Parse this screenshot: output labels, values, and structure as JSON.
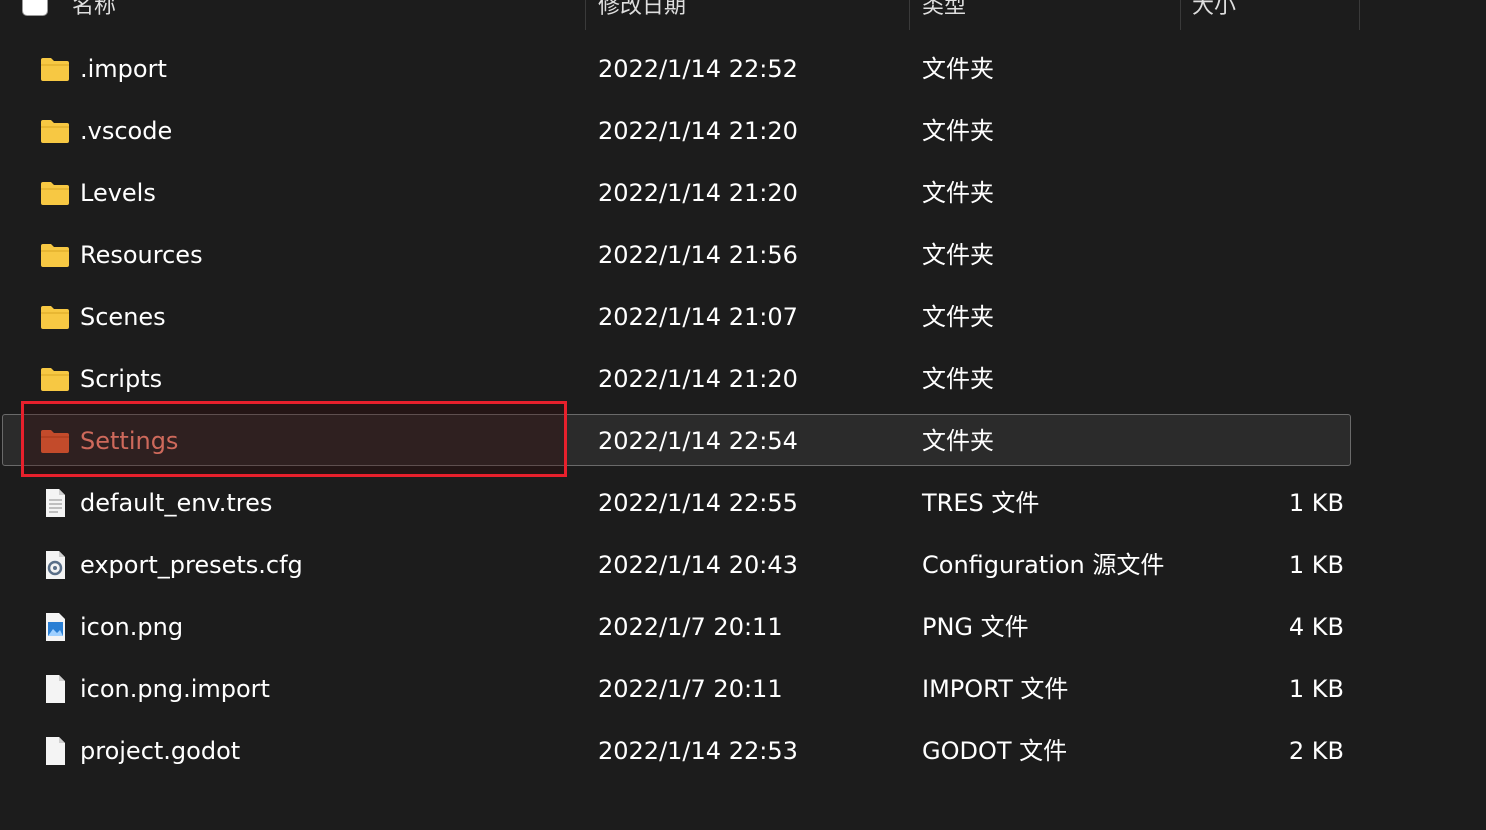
{
  "header": {
    "name": "名称",
    "date": "修改日期",
    "type": "类型",
    "size": "大小"
  },
  "rows": [
    {
      "name": ".import",
      "date": "2022/1/14 22:52",
      "type": "文件夹",
      "size": "",
      "icon": "folder-icon"
    },
    {
      "name": ".vscode",
      "date": "2022/1/14 21:20",
      "type": "文件夹",
      "size": "",
      "icon": "folder-icon"
    },
    {
      "name": "Levels",
      "date": "2022/1/14 21:20",
      "type": "文件夹",
      "size": "",
      "icon": "folder-icon"
    },
    {
      "name": "Resources",
      "date": "2022/1/14 21:56",
      "type": "文件夹",
      "size": "",
      "icon": "folder-icon"
    },
    {
      "name": "Scenes",
      "date": "2022/1/14 21:07",
      "type": "文件夹",
      "size": "",
      "icon": "folder-icon"
    },
    {
      "name": "Scripts",
      "date": "2022/1/14 21:20",
      "type": "文件夹",
      "size": "",
      "icon": "folder-icon"
    },
    {
      "name": "Settings",
      "date": "2022/1/14 22:54",
      "type": "文件夹",
      "size": "",
      "icon": "folder-orange-icon",
      "selected": true
    },
    {
      "name": "default_env.tres",
      "date": "2022/1/14 22:55",
      "type": "TRES 文件",
      "size": "1 KB",
      "icon": "text-file-icon"
    },
    {
      "name": "export_presets.cfg",
      "date": "2022/1/14 20:43",
      "type": "Configuration 源文件",
      "size": "1 KB",
      "icon": "config-file-icon"
    },
    {
      "name": "icon.png",
      "date": "2022/1/7 20:11",
      "type": "PNG 文件",
      "size": "4 KB",
      "icon": "image-file-icon"
    },
    {
      "name": "icon.png.import",
      "date": "2022/1/7 20:11",
      "type": "IMPORT 文件",
      "size": "1 KB",
      "icon": "blank-file-icon"
    },
    {
      "name": "project.godot",
      "date": "2022/1/14 22:53",
      "type": "GODOT 文件",
      "size": "2 KB",
      "icon": "blank-file-icon"
    }
  ],
  "colors": {
    "background": "#1c1c1c",
    "folder": "#f7c843",
    "selected_folder": "#f0643a",
    "selected_text": "#ff8c7a",
    "highlight_box": "#e8202c"
  }
}
